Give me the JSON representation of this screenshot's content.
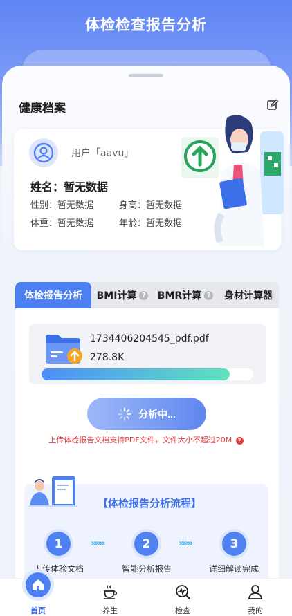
{
  "header": {
    "title": "体检检查报告分析"
  },
  "profile": {
    "section_title": "健康档案",
    "username": "用户「aavu」",
    "name": "姓名：暂无数据",
    "gender": "性别：暂无数据",
    "height": "身高：暂无数据",
    "weight": "体重：暂无数据",
    "age": "年龄：暂无数据"
  },
  "tabs": [
    {
      "label": "体检报告分析"
    },
    {
      "label": "BMI计算"
    },
    {
      "label": "BMR计算"
    },
    {
      "label": "身材计算器"
    }
  ],
  "upload": {
    "file_name": "1734406204545_pdf.pdf",
    "file_size": "278.8K",
    "progress": 0.89,
    "button_label": "分析中...",
    "hint": "上传体检报告文档支持PDF文件，文件大小不超过20M"
  },
  "process": {
    "title": "【体检报告分析流程】",
    "steps": [
      {
        "num": "1",
        "label": "上传体验文档"
      },
      {
        "num": "2",
        "label": "智能分析报告"
      },
      {
        "num": "3",
        "label": "详细解读完成"
      }
    ],
    "arrows": "»»»"
  },
  "nav": [
    {
      "label": "首页",
      "icon": "home-icon"
    },
    {
      "label": "养生",
      "icon": "tea-cup-icon"
    },
    {
      "label": "检查",
      "icon": "check-icon"
    },
    {
      "label": "我的",
      "icon": "user-icon"
    }
  ],
  "colors": {
    "primary": "#4b7ff2",
    "accent_green": "#5fe3be",
    "warning": "#e43d3d"
  }
}
